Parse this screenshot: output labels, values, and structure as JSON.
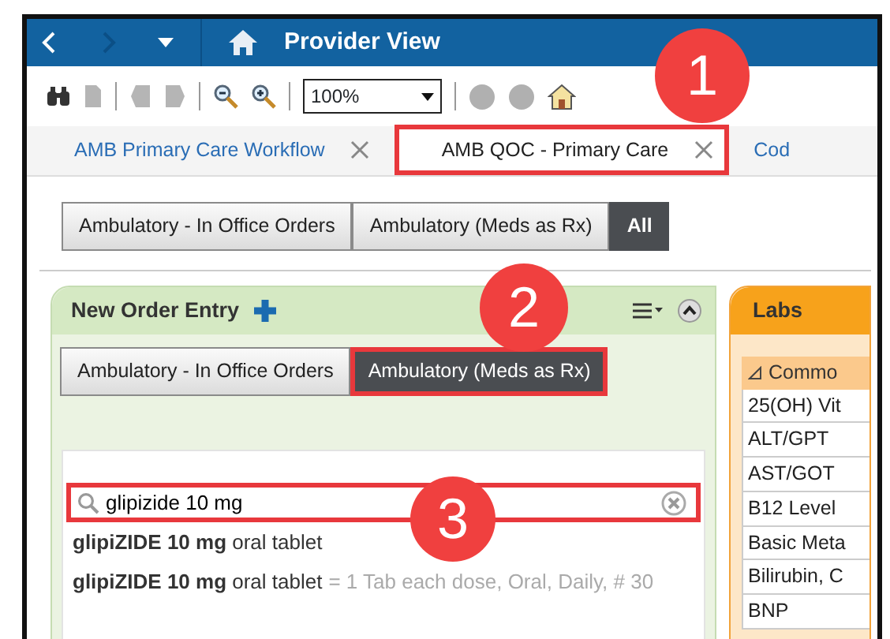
{
  "header": {
    "title": "Provider View"
  },
  "toolbar": {
    "zoom": "100%"
  },
  "tabs": [
    {
      "label": "AMB Primary Care Workflow",
      "selected": false,
      "closable": true,
      "highlighted": false
    },
    {
      "label": "AMB QOC - Primary Care",
      "selected": true,
      "closable": true,
      "highlighted": true
    },
    {
      "label": "Cod",
      "selected": false,
      "closable": false,
      "highlighted": false
    }
  ],
  "filters": [
    {
      "label": "Ambulatory - In Office Orders",
      "selected": false
    },
    {
      "label": "Ambulatory (Meds as Rx)",
      "selected": false
    },
    {
      "label": "All",
      "selected": true
    }
  ],
  "order_panel": {
    "title": "New Order Entry",
    "folders": [
      {
        "label": "Ambulatory - In Office Orders",
        "selected": false,
        "highlighted": false
      },
      {
        "label": "Ambulatory (Meds as Rx)",
        "selected": true,
        "highlighted": true
      }
    ],
    "search": {
      "value": "glipizide 10 mg",
      "highlighted": true
    },
    "results": [
      {
        "text": "**glipiZIDE 10 mg** oral tablet"
      },
      {
        "text": "**glipiZIDE 10 mg** oral tablet",
        "details": "= 1 Tab each dose, Oral, Daily, # 30"
      }
    ]
  },
  "labs_panel": {
    "title": "Labs",
    "group": {
      "label": "Commo",
      "expanded": true
    },
    "items": [
      "25(OH) Vit",
      "ALT/GPT",
      "AST/GOT",
      "B12 Level",
      "Basic Meta",
      "Bilirubin, C",
      "BNP"
    ]
  },
  "callouts": [
    {
      "number": "1"
    },
    {
      "number": "2"
    },
    {
      "number": "3"
    }
  ]
}
